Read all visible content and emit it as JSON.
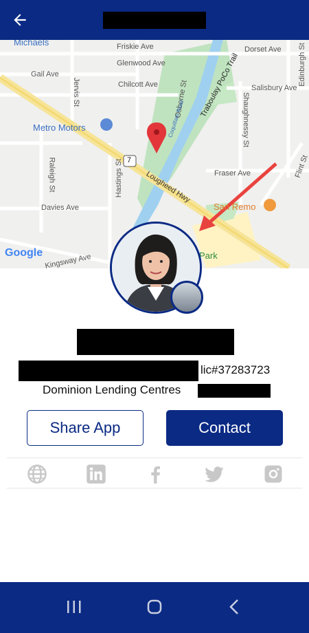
{
  "header": {
    "back_icon": "arrow-left-icon"
  },
  "map": {
    "labels": {
      "michaels": "Michaels",
      "friskie": "Friskie Ave",
      "dorset": "Dorset Ave",
      "gail": "Gail Ave",
      "jervis": "Jervis St",
      "glenwood": "Glenwood Ave",
      "chilcott": "Chilcott Ave",
      "osborne": "Osborne St",
      "traboulay": "Traboulay PoCo Trail",
      "salisbury": "Salisbury Ave",
      "edinburgh": "Edinburgh St",
      "metro": "Metro Motors",
      "coquitlam": "Coquitlam River",
      "shaughnessy": "Shaughnessy St",
      "route7": "7",
      "fraser": "Fraser Ave",
      "flint": "Flint St",
      "raleigh": "Raleigh St",
      "hastings": "Hastings St",
      "lougheed": "Lougheed Hwy",
      "davies": "Davies Ave",
      "sanremo": "San Remo",
      "kingsway": "Kingsway Ave",
      "park": "Park",
      "google": "Google"
    }
  },
  "profile": {
    "license": "lic#37283723",
    "company": "Dominion Lending Centres"
  },
  "actions": {
    "share_label": "Share App",
    "contact_label": "Contact"
  },
  "social": [
    "globe-icon",
    "linkedin-icon",
    "facebook-icon",
    "twitter-icon",
    "instagram-icon"
  ],
  "colors": {
    "primary": "#0a2a84",
    "social_icon": "#c8c8c8"
  }
}
